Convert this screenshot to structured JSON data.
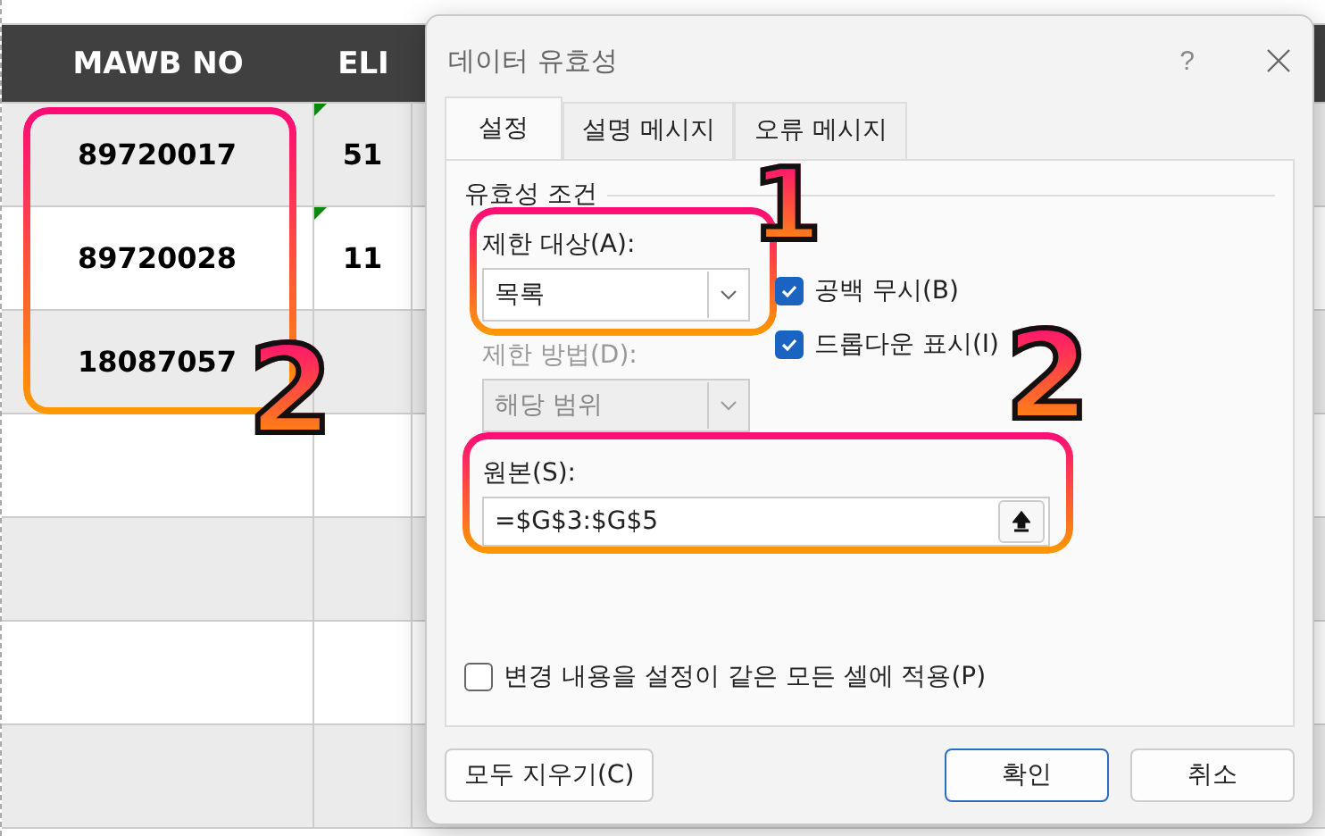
{
  "sheet": {
    "columns": [
      "MAWB NO",
      "ELI"
    ],
    "rows": [
      {
        "mawb": "89720017",
        "eli": "51",
        "flagged": true
      },
      {
        "mawb": "89720028",
        "eli": "11",
        "flagged": true
      },
      {
        "mawb": "18087057",
        "flagged": false
      }
    ]
  },
  "dialog": {
    "title": "데이터 유효성",
    "help": "?",
    "tabs": [
      {
        "label": "설정",
        "selected": true
      },
      {
        "label": "설명 메시지",
        "selected": false
      },
      {
        "label": "오류 메시지",
        "selected": false
      }
    ],
    "group": "유효성 조건",
    "allow": {
      "label": "제한 대상(A):",
      "value": "목록",
      "disabled": false
    },
    "data": {
      "label": "제한 방법(D):",
      "value": "해당 범위",
      "disabled": true
    },
    "checks": [
      {
        "label": "공백 무시(B)",
        "checked": true
      },
      {
        "label": "드롭다운 표시(I)",
        "checked": true
      }
    ],
    "source": {
      "label": "원본(S):",
      "value": "=$G$3:$G$5"
    },
    "apply_all": {
      "label": "변경 내용을 설정이 같은 모든 셀에 적용(P)",
      "checked": false
    },
    "buttons": [
      {
        "label": "모두 지우기(C)",
        "default": false
      },
      {
        "label": "확인",
        "default": true
      },
      {
        "label": "취소",
        "default": false
      }
    ]
  },
  "annotations": [
    "1",
    "2",
    "2"
  ]
}
